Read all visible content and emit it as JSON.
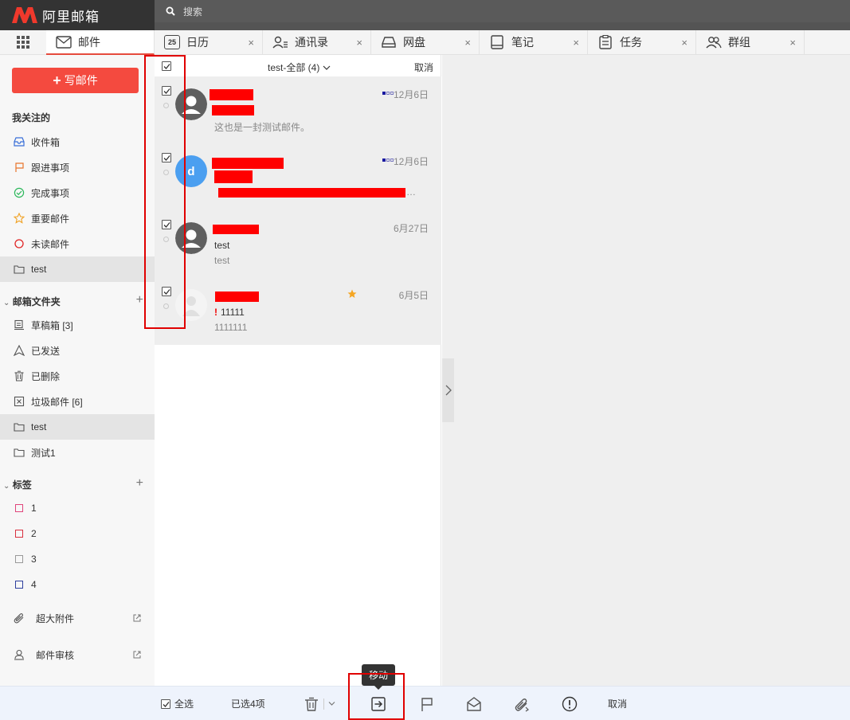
{
  "app": {
    "logo_text": "阿里邮箱"
  },
  "search": {
    "placeholder": "搜索"
  },
  "tabs": [
    {
      "label": "邮件",
      "icon": "mail-icon"
    },
    {
      "label": "日历",
      "icon": "calendar-icon",
      "icon_text": "25",
      "close": "×"
    },
    {
      "label": "通讯录",
      "icon": "contacts-icon",
      "close": "×"
    },
    {
      "label": "网盘",
      "icon": "drive-icon",
      "close": "×"
    },
    {
      "label": "笔记",
      "icon": "notes-icon",
      "close": "×"
    },
    {
      "label": "任务",
      "icon": "tasks-icon",
      "close": "×"
    },
    {
      "label": "群组",
      "icon": "group-icon",
      "close": "×"
    }
  ],
  "sidebar": {
    "compose_label": "写邮件",
    "favorites_heading": "我关注的",
    "favorites": [
      {
        "label": "收件箱",
        "icon": "inbox-icon"
      },
      {
        "label": "跟进事项",
        "icon": "flag-icon"
      },
      {
        "label": "完成事项",
        "icon": "check-circle-icon"
      },
      {
        "label": "重要邮件",
        "icon": "star-icon"
      },
      {
        "label": "未读邮件",
        "icon": "unread-circle-icon"
      },
      {
        "label": "test",
        "icon": "folder-icon",
        "selected": true
      }
    ],
    "folders_heading": "邮箱文件夹",
    "folders": [
      {
        "label": "草稿箱 [3]",
        "icon": "drafts-icon"
      },
      {
        "label": "已发送",
        "icon": "sent-icon"
      },
      {
        "label": "已删除",
        "icon": "trash-icon"
      },
      {
        "label": "垃圾邮件 [6]",
        "icon": "spam-icon"
      },
      {
        "label": "test",
        "icon": "folder-icon",
        "selected": true
      },
      {
        "label": "测试1",
        "icon": "folder-icon"
      }
    ],
    "tags_heading": "标签",
    "tags": [
      {
        "label": "1",
        "color": "#e0457b"
      },
      {
        "label": "2",
        "color": "#d9303f"
      },
      {
        "label": "3",
        "color": "#999999"
      },
      {
        "label": "4",
        "color": "#2e3f9e"
      }
    ],
    "extras": [
      {
        "label": "超大附件",
        "icon": "paperclip-icon"
      },
      {
        "label": "邮件审核",
        "icon": "reviewer-icon"
      }
    ]
  },
  "list": {
    "title": "test-全部 (4)",
    "cancel_label": "取消",
    "mails": [
      {
        "date": "12月6日",
        "subject": "",
        "preview": "这也是一封测试邮件。",
        "avatar": "person",
        "tags": true
      },
      {
        "date": "12月6日",
        "subject": "",
        "preview": "",
        "avatar": "letter",
        "avatar_letter": "d",
        "tags": true
      },
      {
        "date": "6月27日",
        "subject": "test",
        "preview": "test",
        "avatar": "person"
      },
      {
        "date": "6月5日",
        "subject": "11111",
        "preview": "1111111",
        "avatar": "ghost",
        "starred": true,
        "important_mark": "!"
      }
    ]
  },
  "toolbar": {
    "select_all": "全选",
    "selected_count": "已选4项",
    "move_tooltip": "移动",
    "cancel": "取消"
  },
  "colors": {
    "accent": "#f44a3f",
    "toolbar_bg": "#eef3fc",
    "highlight": "#e00000"
  }
}
